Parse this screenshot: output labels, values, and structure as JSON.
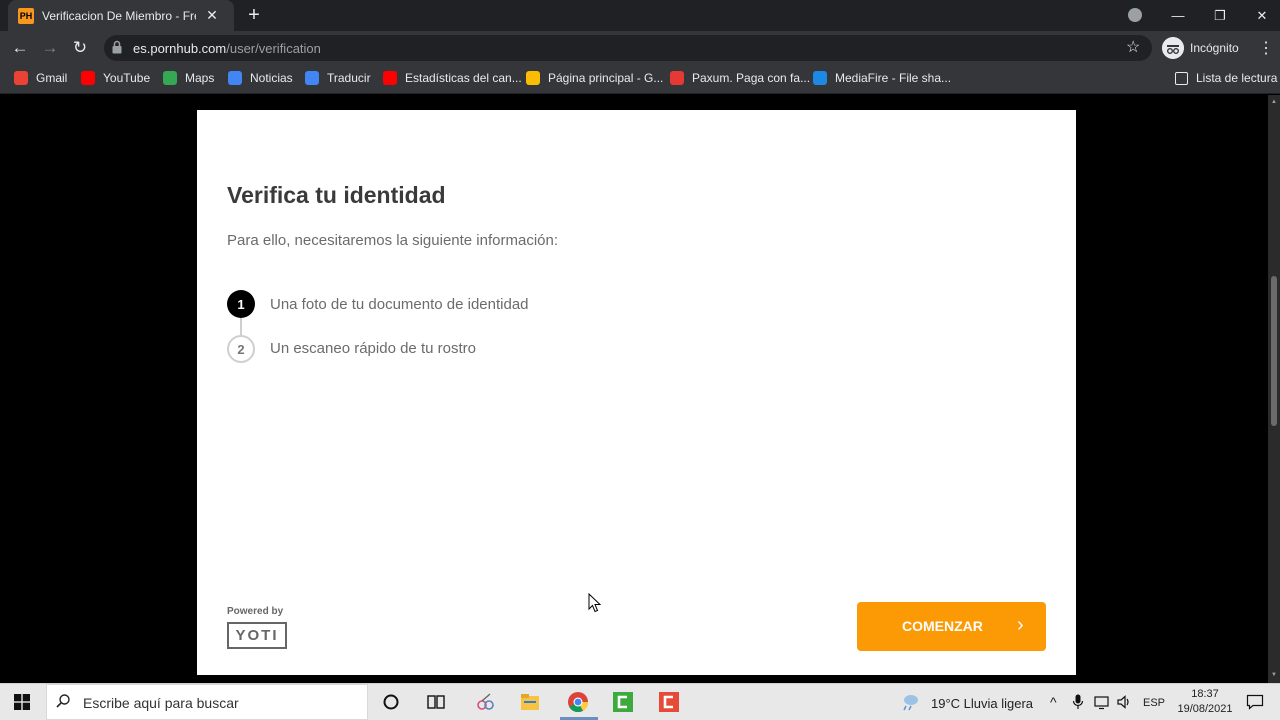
{
  "browser": {
    "tab_title": "Verificacion De Miembro - Free P",
    "tab_favicon": "PH",
    "url_domain": "es.pornhub.com",
    "url_path": "/user/verification",
    "incognito_label": "Incógnito",
    "bookmarks": [
      {
        "label": "Gmail",
        "icon": "gmail-icon",
        "color": "#ea4335"
      },
      {
        "label": "YouTube",
        "icon": "youtube-icon",
        "color": "#ff0000"
      },
      {
        "label": "Maps",
        "icon": "maps-icon",
        "color": "#34a853"
      },
      {
        "label": "Noticias",
        "icon": "news-icon",
        "color": "#4285f4"
      },
      {
        "label": "Traducir",
        "icon": "translate-icon",
        "color": "#4285f4"
      },
      {
        "label": "Estadísticas del can...",
        "icon": "youtube-icon",
        "color": "#ff0000"
      },
      {
        "label": "Página principal - G...",
        "icon": "adsense-icon",
        "color": "#fbbc04"
      },
      {
        "label": "Paxum. Paga con fa...",
        "icon": "paxum-icon",
        "color": "#e53935"
      },
      {
        "label": "MediaFire - File sha...",
        "icon": "mediafire-icon",
        "color": "#1e88e5"
      }
    ],
    "reading_list_label": "Lista de lectura"
  },
  "page": {
    "title": "Verifica tu identidad",
    "subtitle": "Para ello, necesitaremos la siguiente información:",
    "steps": [
      {
        "number": "1",
        "label": "Una foto de tu documento de identidad"
      },
      {
        "number": "2",
        "label": "Un escaneo rápido de tu rostro"
      }
    ],
    "powered_by": "Powered by",
    "brand": "YOTI",
    "cta_label": "COMENZAR",
    "cta_color": "#fb9a05"
  },
  "taskbar": {
    "search_placeholder": "Escribe aquí para buscar",
    "weather": "19°C  Lluvia ligera",
    "language": "ESP",
    "time": "18:37",
    "date": "19/08/2021"
  }
}
